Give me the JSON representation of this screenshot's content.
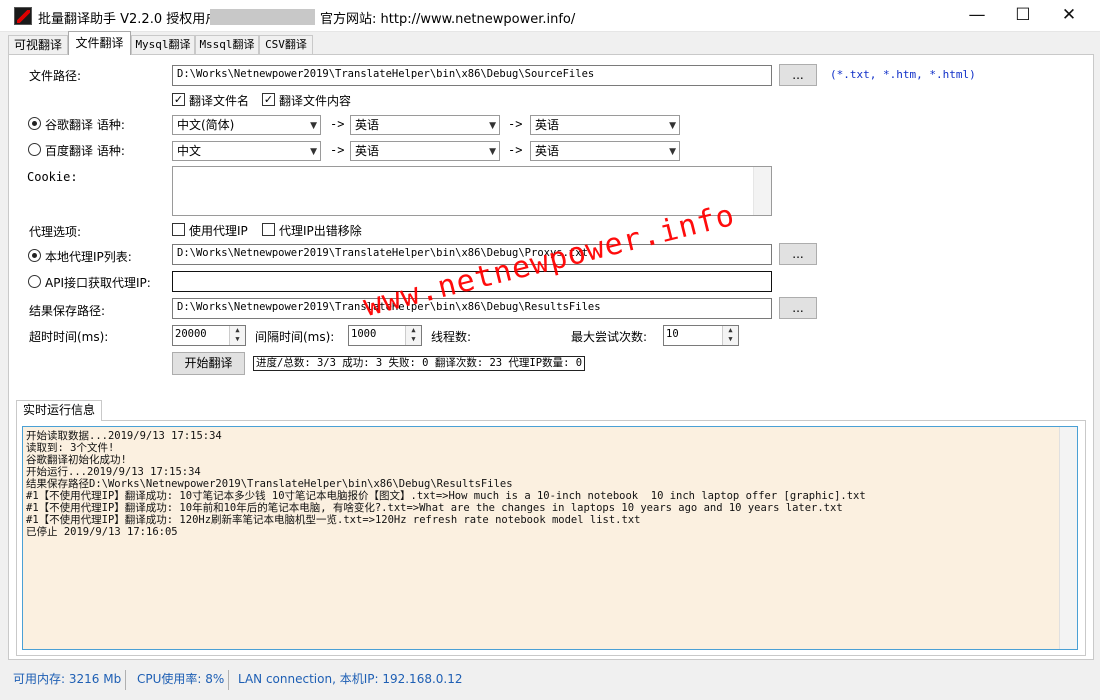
{
  "titlebar": {
    "title": "批量翻译助手 V2.2.0  授权用户:",
    "site_label": "官方网站: http://www.netnewpower.info/",
    "minimize": "—",
    "maximize": "☐",
    "close": "✕"
  },
  "tabs": [
    "可视翻译",
    "文件翻译",
    "Mysql翻译",
    "Mssql翻译",
    "CSV翻译"
  ],
  "form": {
    "file_path_label": "文件路径:",
    "file_path_value": "D:\\Works\\Netnewpower2019\\TranslateHelper\\bin\\x86\\Debug\\SourceFiles",
    "browse": "...",
    "ext_hint": "(*.txt, *.htm, *.html)",
    "chk_filename": "翻译文件名",
    "chk_content": "翻译文件内容",
    "google_label": "谷歌翻译 语种:",
    "baidu_label": "百度翻译 语种:",
    "arrow": "->",
    "google_src": "中文(简体)",
    "google_mid": "英语",
    "google_dst": "英语",
    "baidu_src": "中文",
    "baidu_mid": "英语",
    "baidu_dst": "英语",
    "cookie_label": "Cookie:",
    "proxy_label": "代理选项:",
    "use_proxy": "使用代理IP",
    "proxy_remove": "代理IP出错移除",
    "local_proxy_label": "本地代理IP列表:",
    "local_proxy_value": "D:\\Works\\Netnewpower2019\\TranslateHelper\\bin\\x86\\Debug\\Proxys.txt",
    "api_proxy_label": "API接口获取代理IP:",
    "result_label": "结果保存路径:",
    "result_value": "D:\\Works\\Netnewpower2019\\TranslateHelper\\bin\\x86\\Debug\\ResultsFiles",
    "timeout_label": "超时时间(ms):",
    "timeout_value": "20000",
    "interval_label": "间隔时间(ms):",
    "interval_value": "1000",
    "threads_label": "线程数:",
    "retries_label": "最大尝试次数:",
    "retries_value": "10",
    "start_button": "开始翻译",
    "progress": "进度/总数: 3/3 成功: 3 失败: 0 翻译次数: 23 代理IP数量: 0"
  },
  "watermark": "www.netnewpower.info",
  "log": {
    "tab": "实时运行信息",
    "lines": [
      "开始读取数据...2019/9/13 17:15:34",
      "读取到: 3个文件!",
      "谷歌翻译初始化成功!",
      "开始运行...2019/9/13 17:15:34",
      "结果保存路径D:\\Works\\Netnewpower2019\\TranslateHelper\\bin\\x86\\Debug\\ResultsFiles",
      "#1【不使用代理IP】翻译成功: 10寸笔记本多少钱 10寸笔记本电脑报价【图文】.txt=>How much is a 10-inch notebook  10 inch laptop offer [graphic].txt",
      "#1【不使用代理IP】翻译成功: 10年前和10年后的笔记本电脑, 有啥变化?.txt=>What are the changes in laptops 10 years ago and 10 years later.txt",
      "#1【不使用代理IP】翻译成功: 120Hz刷新率笔记本电脑机型一览.txt=>120Hz refresh rate notebook model list.txt",
      "已停止 2019/9/13 17:16:05"
    ]
  },
  "status": {
    "memory": "可用内存: 3216 Mb",
    "cpu": "CPU使用率: 8%",
    "network": "LAN connection, 本机IP: 192.168.0.12"
  }
}
